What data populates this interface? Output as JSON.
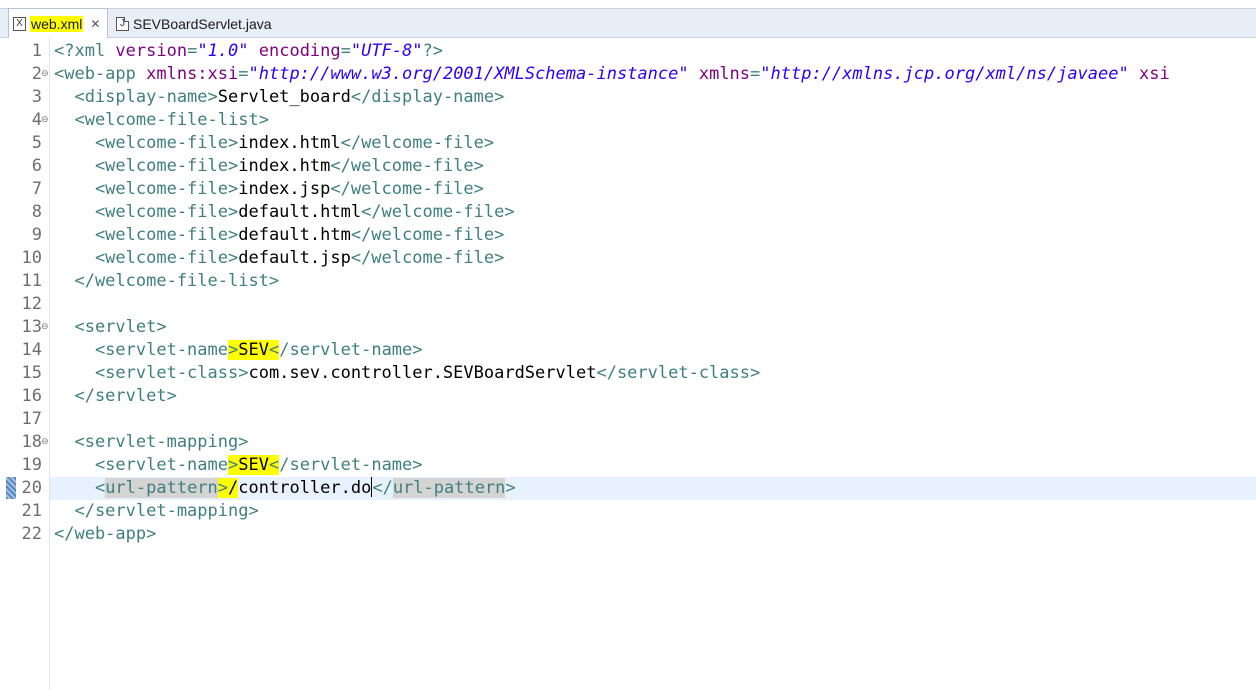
{
  "tabs": [
    {
      "label": "web.xml",
      "icon": "xml-file-icon",
      "active": true
    },
    {
      "label": "SEVBoardServlet.java",
      "icon": "java-file-icon",
      "active": false
    }
  ],
  "tab_close_glyph": "✕",
  "current_line": 20,
  "lines": [
    {
      "n": "1",
      "fold": false,
      "tokens": [
        [
          "pi",
          "<?xml "
        ],
        [
          "attr",
          "version"
        ],
        [
          "tag",
          "="
        ],
        [
          "str",
          "\"1.0\""
        ],
        [
          "attr",
          " encoding"
        ],
        [
          "tag",
          "="
        ],
        [
          "str",
          "\"UTF-8\""
        ],
        [
          "pi",
          "?>"
        ]
      ]
    },
    {
      "n": "2",
      "fold": true,
      "tokens": [
        [
          "tag",
          "<web-app "
        ],
        [
          "attr",
          "xmlns:xsi"
        ],
        [
          "tag",
          "="
        ],
        [
          "str",
          "\"http://www.w3.org/2001/XMLSchema-instance\""
        ],
        [
          "attr",
          " xmlns"
        ],
        [
          "tag",
          "="
        ],
        [
          "str",
          "\"http://xmlns.jcp.org/xml/ns/javaee\""
        ],
        [
          "attr",
          " xsi"
        ]
      ]
    },
    {
      "n": "3",
      "fold": false,
      "tokens": [
        [
          "tag",
          "  <display-name>"
        ],
        [
          "text",
          "Servlet_board"
        ],
        [
          "tag",
          "</display-name>"
        ]
      ]
    },
    {
      "n": "4",
      "fold": true,
      "tokens": [
        [
          "tag",
          "  <welcome-file-list>"
        ]
      ]
    },
    {
      "n": "5",
      "fold": false,
      "tokens": [
        [
          "tag",
          "    <welcome-file>"
        ],
        [
          "text",
          "index.html"
        ],
        [
          "tag",
          "</welcome-file>"
        ]
      ]
    },
    {
      "n": "6",
      "fold": false,
      "tokens": [
        [
          "tag",
          "    <welcome-file>"
        ],
        [
          "text",
          "index.htm"
        ],
        [
          "tag",
          "</welcome-file>"
        ]
      ]
    },
    {
      "n": "7",
      "fold": false,
      "tokens": [
        [
          "tag",
          "    <welcome-file>"
        ],
        [
          "text",
          "index.jsp"
        ],
        [
          "tag",
          "</welcome-file>"
        ]
      ]
    },
    {
      "n": "8",
      "fold": false,
      "tokens": [
        [
          "tag",
          "    <welcome-file>"
        ],
        [
          "text",
          "default.html"
        ],
        [
          "tag",
          "</welcome-file>"
        ]
      ]
    },
    {
      "n": "9",
      "fold": false,
      "tokens": [
        [
          "tag",
          "    <welcome-file>"
        ],
        [
          "text",
          "default.htm"
        ],
        [
          "tag",
          "</welcome-file>"
        ]
      ]
    },
    {
      "n": "10",
      "fold": false,
      "tokens": [
        [
          "tag",
          "    <welcome-file>"
        ],
        [
          "text",
          "default.jsp"
        ],
        [
          "tag",
          "</welcome-file>"
        ]
      ]
    },
    {
      "n": "11",
      "fold": false,
      "tokens": [
        [
          "tag",
          "  </welcome-file-list>"
        ]
      ]
    },
    {
      "n": "12",
      "fold": false,
      "tokens": []
    },
    {
      "n": "13",
      "fold": true,
      "tokens": [
        [
          "tag",
          "  <servlet>"
        ]
      ]
    },
    {
      "n": "14",
      "fold": false,
      "tokens": [
        [
          "tag",
          "    <servlet-name"
        ],
        [
          "tag-hl",
          ">"
        ],
        [
          "text-hl",
          "SEV"
        ],
        [
          "tag-hl",
          "<"
        ],
        [
          "tag",
          "/servlet-name>"
        ]
      ]
    },
    {
      "n": "15",
      "fold": false,
      "tokens": [
        [
          "tag",
          "    <servlet-class>"
        ],
        [
          "text",
          "com.sev.controller.SEVBoardServlet"
        ],
        [
          "tag",
          "</servlet-class>"
        ]
      ]
    },
    {
      "n": "16",
      "fold": false,
      "tokens": [
        [
          "tag",
          "  </servlet>"
        ]
      ]
    },
    {
      "n": "17",
      "fold": false,
      "tokens": []
    },
    {
      "n": "18",
      "fold": true,
      "tokens": [
        [
          "tag",
          "  <servlet-mapping>"
        ]
      ]
    },
    {
      "n": "19",
      "fold": false,
      "tokens": [
        [
          "tag",
          "    <servlet-name"
        ],
        [
          "tag-hl",
          ">"
        ],
        [
          "text-hl",
          "SEV"
        ],
        [
          "tag-hl",
          "<"
        ],
        [
          "tag",
          "/servlet-name>"
        ]
      ]
    },
    {
      "n": "20",
      "fold": false,
      "tokens": [
        [
          "tag",
          "    <"
        ],
        [
          "tag-match",
          "url-pattern"
        ],
        [
          "tag-hl",
          ">"
        ],
        [
          "text-hl",
          "/"
        ],
        [
          "text",
          "controller.do"
        ],
        [
          "cursor",
          ""
        ],
        [
          "tag",
          "</"
        ],
        [
          "tag-match",
          "url-pattern"
        ],
        [
          "tag",
          ">"
        ]
      ]
    },
    {
      "n": "21",
      "fold": false,
      "tokens": [
        [
          "tag",
          "  </servlet-mapping>"
        ]
      ]
    },
    {
      "n": "22",
      "fold": false,
      "tokens": [
        [
          "tag",
          "</web-app>"
        ]
      ]
    }
  ]
}
